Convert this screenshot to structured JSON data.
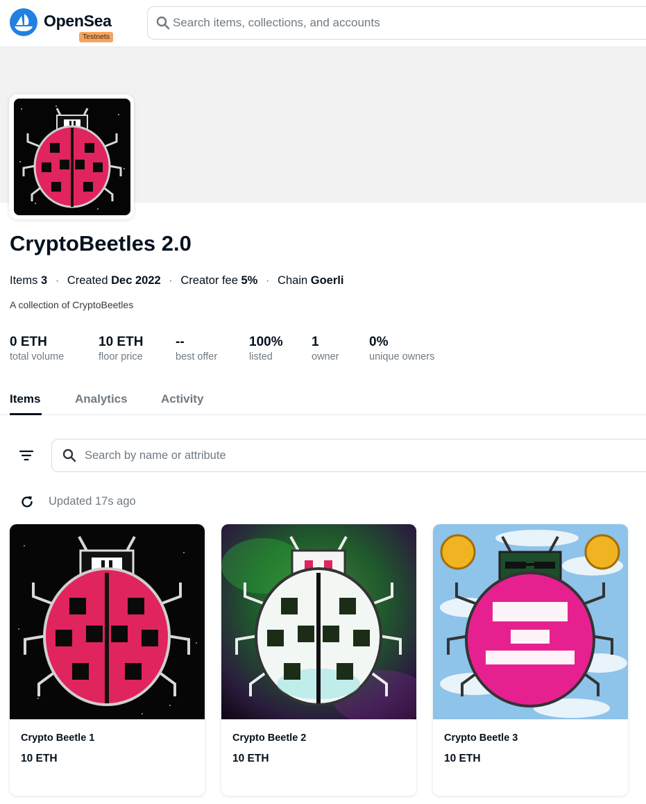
{
  "header": {
    "logo_text": "OpenSea",
    "badge": "Testnets",
    "search_placeholder": "Search items, collections, and accounts"
  },
  "collection": {
    "title": "CryptoBeetles 2.0",
    "meta": [
      {
        "label": "Items",
        "value": "3"
      },
      {
        "label": "Created",
        "value": "Dec 2022"
      },
      {
        "label": "Creator fee",
        "value": "5%"
      },
      {
        "label": "Chain",
        "value": "Goerli"
      }
    ],
    "description": "A collection of CryptoBeetles"
  },
  "stats": [
    {
      "value": "0 ETH",
      "label": "total volume"
    },
    {
      "value": "10 ETH",
      "label": "floor price"
    },
    {
      "value": "--",
      "label": "best offer"
    },
    {
      "value": "100%",
      "label": "listed"
    },
    {
      "value": "1",
      "label": "owner"
    },
    {
      "value": "0%",
      "label": "unique owners"
    }
  ],
  "tabs": [
    {
      "label": "Items",
      "active": true
    },
    {
      "label": "Analytics",
      "active": false
    },
    {
      "label": "Activity",
      "active": false
    }
  ],
  "items_toolbar": {
    "search_placeholder": "Search by name or attribute",
    "updated": "Updated 17s ago"
  },
  "items": [
    {
      "name": "Crypto Beetle 1",
      "price": "10 ETH"
    },
    {
      "name": "Crypto Beetle 2",
      "price": "10 ETH"
    },
    {
      "name": "Crypto Beetle 3",
      "price": "10 ETH"
    }
  ],
  "colors": {
    "brand": "#2081e2",
    "badge": "#f5a460",
    "text": "#04111d",
    "muted": "#707a83"
  }
}
